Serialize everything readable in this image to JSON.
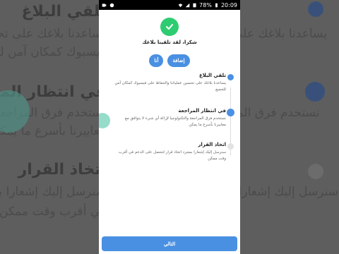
{
  "status_bar": {
    "battery": "78%",
    "time": "20:09"
  },
  "confirmation": {
    "message": "شكرا، لقد تلقينا بلاغك"
  },
  "actions": {
    "add_label": "إضافة",
    "me_label": "أنا"
  },
  "steps": [
    {
      "title": "تلقي البلاغ",
      "description": "يساعدنا بلاغك على تحسين عملياتنا والحفاظ على فيسبوك كمكان آمن للجميع"
    },
    {
      "title": "في انتظار المراجعة",
      "description": "نستخدم فرق المراجعة والتكنولوجيا لإزالة أي شيء لا يتوافق مع معاييرنا بأسرع ما يمكن"
    },
    {
      "title": "اتخاذ القرار",
      "description": "سنرسل إليك إشعارا بمجرد اتخاذ قرار لتحصل على الدعم في أقرب وقت ممكن"
    }
  ],
  "footer": {
    "next_label": "التالي"
  },
  "background": {
    "heading_1": "تلقي البلاغ",
    "line_1a": "يساعدنا بلاغك على تحسين عملياتنا والحفاظ على",
    "line_1b": "فيسبوك كمكان آمن للجميع",
    "heading_2": "في انتظار المراجعة",
    "line_2a": "نستخدم فرق المراجعة لإزالة أي شيء لا يتوافق",
    "line_2b": "معاييرنا بأسرع ما يمكن",
    "heading_3": "اتخاذ القرار",
    "line_3a": "سنرسل إليك إشعارا بمجرد اتخاذ قرار لتحصل على الدعم",
    "line_3b": "في أقرب وقت ممكن"
  },
  "colors": {
    "accent": "#4a90e2",
    "success": "#2ecc71",
    "touch_indicator": "#3fbf9f"
  }
}
